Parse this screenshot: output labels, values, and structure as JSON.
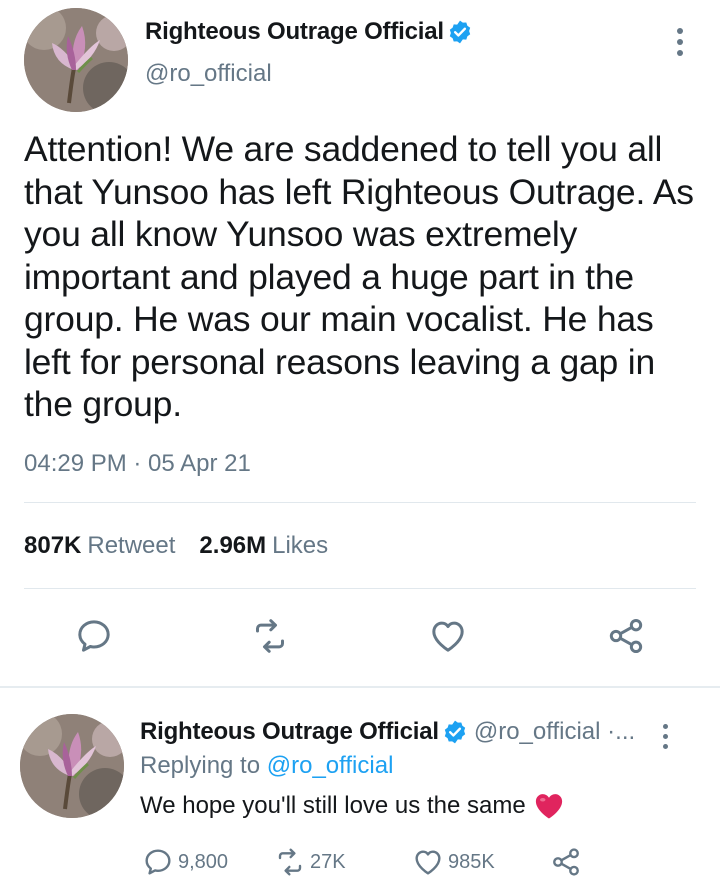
{
  "main_tweet": {
    "display_name": "Righteous Outrage Official",
    "handle": "@ro_official",
    "text": "Attention! We are saddened to tell you all that Yunsoo has left Righteous Outrage. As you all know Yunsoo was extremely important and played a huge part in the group. He was our main vocalist. He has left for personal reasons leaving a gap in the group.",
    "timestamp": "04:29 PM · 05 Apr 21",
    "retweets_count": "807K",
    "retweets_label": "Retweet",
    "likes_count": "2.96M",
    "likes_label": "Likes"
  },
  "reply": {
    "display_name": "Righteous Outrage Official",
    "handle": "@ro_official ·...",
    "replying_prefix": "Replying to",
    "replying_to": "@ro_official",
    "text": "We hope you'll still love us the same",
    "reply_count": "9,800",
    "retweet_count": "27K",
    "like_count": "985K"
  },
  "icons": [
    "verified-badge-icon",
    "more-options-icon",
    "reply-icon",
    "retweet-icon",
    "like-icon",
    "share-icon",
    "red-heart-emoji"
  ],
  "colors": {
    "accent": "#1da1f2",
    "text_primary": "#14171a",
    "text_secondary": "#657786",
    "divider": "#e1e8ed"
  }
}
